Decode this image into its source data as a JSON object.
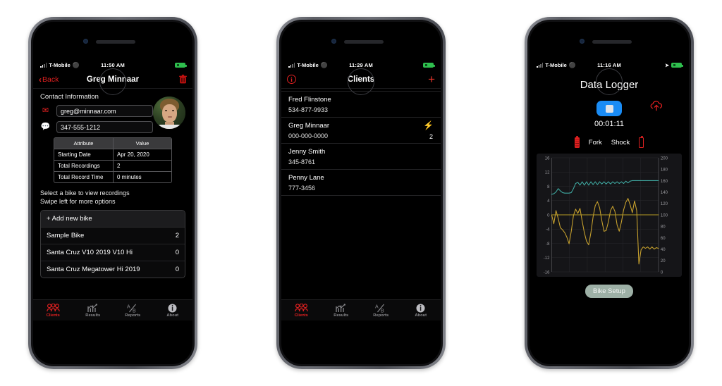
{
  "phone1": {
    "status": {
      "carrier": "T-Mobile",
      "time": "11:50 AM"
    },
    "nav": {
      "back": "Back",
      "title": "Greg Minnaar",
      "delete_icon": "trash-icon"
    },
    "section_title": "Contact Information",
    "email": "greg@minnaar.com",
    "phone": "347-555-1212",
    "table": {
      "headers": [
        "Attribute",
        "Value"
      ],
      "rows": [
        [
          "Starting Date",
          "Apr 20, 2020"
        ],
        [
          "Total Recordings",
          "2"
        ],
        [
          "Total Record Time",
          "0 minutes"
        ]
      ]
    },
    "hint_line1": "Select a bike to view recordings",
    "hint_line2": "Swipe left for more options",
    "add_bike": "+  Add new bike",
    "bikes": [
      {
        "name": "Sample Bike",
        "count": "2"
      },
      {
        "name": "Santa Cruz V10 2019 V10 Hi",
        "count": "0"
      },
      {
        "name": "Santa Cruz Megatower Hi 2019",
        "count": "0"
      }
    ]
  },
  "phone2": {
    "status": {
      "carrier": "T-Mobile",
      "time": "11:29 AM"
    },
    "nav": {
      "title": "Clients",
      "info_icon": "info-icon",
      "add_icon": "plus-icon"
    },
    "clients": [
      {
        "name": "Fred Flinstone",
        "phone": "534-877-9933",
        "bolt": false,
        "count": ""
      },
      {
        "name": "Greg Minnaar",
        "phone": "000-000-0000",
        "bolt": true,
        "count": "2"
      },
      {
        "name": "Jenny Smith",
        "phone": "345-8761",
        "bolt": false,
        "count": ""
      },
      {
        "name": "Penny Lane",
        "phone": "777-3456",
        "bolt": false,
        "count": ""
      }
    ]
  },
  "phone3": {
    "status": {
      "carrier": "T-Mobile",
      "time": "11:16 AM"
    },
    "title": "Data Logger",
    "stop_button": "stop-button",
    "upload_icon": "cloud-upload-icon",
    "timer": "00:01:11",
    "fork_label": "Fork",
    "shock_label": "Shock",
    "setup_button": "Bike Setup",
    "chart_data": {
      "type": "line",
      "title": "",
      "xlabel": "",
      "ylabel": "",
      "grid": true,
      "legend": "none",
      "left_axis": {
        "label": "",
        "ticks": [
          16,
          12,
          8,
          4,
          0,
          -4,
          -8,
          -12,
          -16
        ],
        "ylim": [
          -16,
          16
        ],
        "color": "#d8b24a"
      },
      "right_axis": {
        "label": "",
        "ticks": [
          200,
          180,
          160,
          140,
          120,
          100,
          80,
          60,
          40,
          20,
          0
        ],
        "ylim": [
          0,
          200
        ],
        "color": "#3fa8a0"
      },
      "series": [
        {
          "name": "Shock (right axis)",
          "color": "#3fa8a0",
          "axis": "right",
          "values": [
            136,
            137,
            140,
            146,
            142,
            139,
            138,
            138,
            138,
            139,
            146,
            155,
            157,
            152,
            158,
            152,
            158,
            152,
            158,
            153,
            158,
            153,
            158,
            154,
            158,
            154,
            158,
            154,
            158,
            155,
            158,
            155,
            158,
            155,
            159,
            156,
            159,
            160,
            160,
            160,
            160,
            160,
            160,
            160,
            160,
            160,
            160,
            160,
            160,
            160
          ]
        },
        {
          "name": "Fork (left axis)",
          "color": "#c8a22e",
          "axis": "left",
          "values": [
            0,
            -2.5,
            1.2,
            -1.0,
            -3.6,
            -4.2,
            -5.0,
            -6.3,
            -8.1,
            -4.6,
            -0.2,
            1.6,
            0.4,
            1.8,
            -1.8,
            -5.0,
            -7.4,
            -8.4,
            -5.0,
            -0.6,
            2.6,
            3.7,
            2.0,
            -1.6,
            -4.6,
            -4.4,
            -2.0,
            1.2,
            2.4,
            1.0,
            -2.8,
            -4.6,
            -2.0,
            1.4,
            3.5,
            4.6,
            2.8,
            0.6,
            3.9,
            1.2,
            -13.8,
            -9.8,
            -9.0,
            -9.4,
            -9.0,
            -9.6,
            -9.0,
            -9.6,
            -9.2,
            -9.4
          ]
        },
        {
          "name": "Zero reference (right axis)",
          "color": "#b59a25",
          "axis": "right",
          "values": [
            100,
            100,
            100,
            100,
            100,
            100,
            100,
            100,
            100,
            100,
            100,
            100,
            100,
            100,
            100,
            100,
            100,
            100,
            100,
            100,
            100,
            100,
            100,
            100,
            100,
            100,
            100,
            100,
            100,
            100,
            100,
            100,
            100,
            100,
            100,
            100,
            100,
            100,
            100,
            100,
            100,
            100,
            100,
            100,
            100,
            100,
            100,
            100,
            100,
            100
          ]
        }
      ]
    }
  },
  "tabbar": {
    "tabs": [
      {
        "label": "Clients",
        "icon": "clients-icon",
        "active": true
      },
      {
        "label": "Results",
        "icon": "results-icon",
        "active": false
      },
      {
        "label": "Reports",
        "icon": "reports-icon",
        "active": false
      },
      {
        "label": "About",
        "icon": "about-icon",
        "active": false
      }
    ]
  },
  "colors": {
    "accent_red": "#e02020",
    "accent_blue": "#1a8cf5",
    "teal": "#3fa8a0",
    "gold": "#c8a22e"
  }
}
